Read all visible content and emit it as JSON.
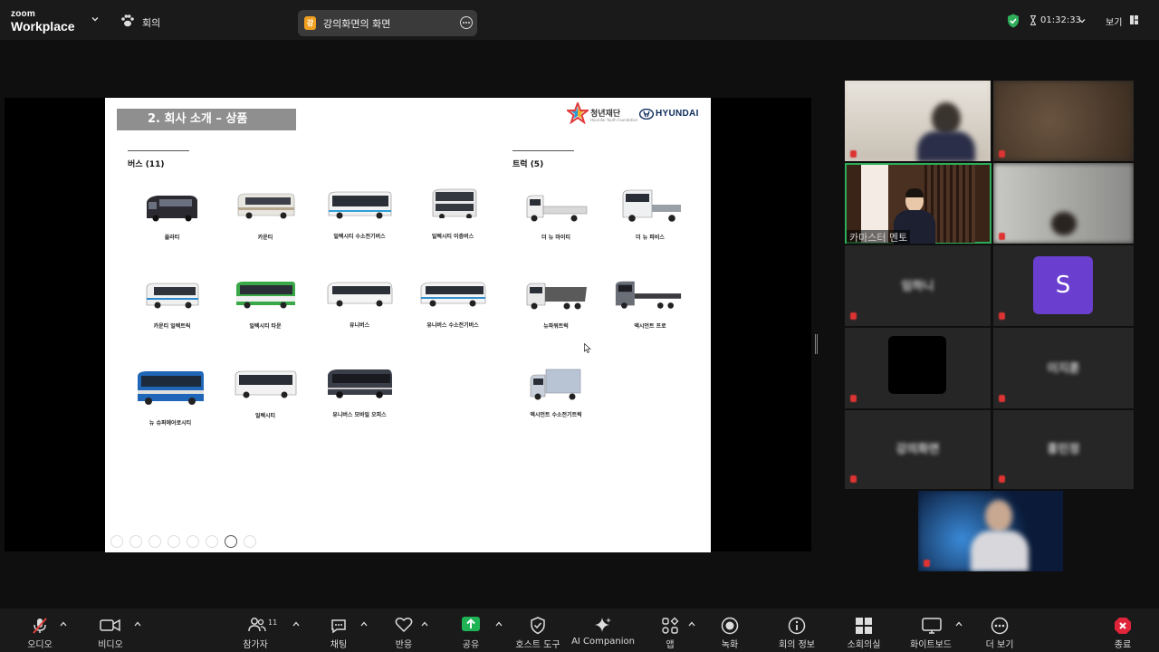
{
  "app": {
    "brand_top": "zoom",
    "brand_bottom": "Workplace"
  },
  "topbar": {
    "meeting_label": "회의",
    "share_badge": "강",
    "share_title": "강의화면의 화면",
    "timer": "01:32:33",
    "view_label": "보기"
  },
  "slide": {
    "title": "2. 회사 소개 – 상품",
    "logo_foundation": "청년재단",
    "logo_foundation_sub": "Hyundai Youth Foundation",
    "logo_hyundai": "HYUNDAI",
    "bus_section": "버스 (11)",
    "truck_section": "트럭 (5)",
    "buses": [
      "쏠라티",
      "카운티",
      "일렉시티 수소전기버스",
      "일렉시티 이층버스",
      "카운티 일렉트릭",
      "일렉시티 타운",
      "유니버스",
      "유니버스 수소전기버스",
      "뉴 슈퍼에어로시티",
      "일렉시티",
      "유니버스 모바일 오피스"
    ],
    "trucks": [
      "더 뉴 마이티",
      "더 뉴 파비스",
      "뉴파워트럭",
      "엑시언트 프로",
      "엑시언트 수소전기트럭"
    ]
  },
  "gallery": {
    "active_speaker": "카마스터 멘토",
    "name_tile_1": "임하니",
    "avatar_letter": "S",
    "name_tile_2": "이지훈",
    "name_tile_3": "강의화면",
    "name_tile_4": "홍민정",
    "accent_avatar": "#6a3fd0",
    "accent_active": "#2fae5a"
  },
  "toolbar": {
    "audio": "오디오",
    "video": "비디오",
    "participants": "참가자",
    "participants_count": "11",
    "chat": "채팅",
    "react": "반응",
    "share": "공유",
    "host_tools": "호스트 도구",
    "ai_companion": "AI Companion",
    "apps": "앱",
    "record": "녹화",
    "meeting_info": "회의 정보",
    "breakout": "소회의실",
    "whiteboard": "화이트보드",
    "more": "더 보기",
    "end": "종료"
  }
}
